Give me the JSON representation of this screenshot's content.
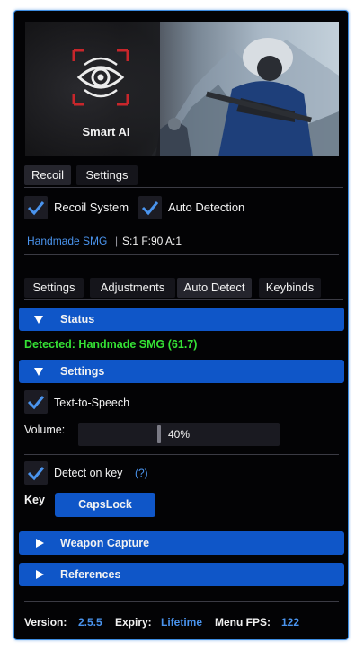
{
  "banner": {
    "logo_label": "Smart AI"
  },
  "main_tabs": [
    {
      "label": "Recoil"
    },
    {
      "label": "Settings"
    }
  ],
  "toggles": {
    "recoil_system": {
      "label": "Recoil System",
      "checked": true
    },
    "auto_detection": {
      "label": "Auto Detection",
      "checked": true
    }
  },
  "weapon_info": {
    "name": "Handmade SMG",
    "separator": "|",
    "stats": "S:1 F:90 A:1"
  },
  "sub_tabs": [
    {
      "label": "Settings"
    },
    {
      "label": "Adjustments"
    },
    {
      "label": "Auto Detect"
    },
    {
      "label": "Keybinds"
    }
  ],
  "sections": {
    "status": {
      "title": "Status",
      "expanded": true
    },
    "settings": {
      "title": "Settings",
      "expanded": true
    },
    "weapon_capture": {
      "title": "Weapon Capture",
      "expanded": false
    },
    "references": {
      "title": "References",
      "expanded": false
    }
  },
  "status": {
    "detected_text": "Detected: Handmade SMG (61.7)"
  },
  "settings": {
    "tts": {
      "label": "Text-to-Speech",
      "checked": true
    },
    "volume": {
      "label": "Volume:",
      "value_text": "40%",
      "value": 0.4
    },
    "detect_on_key": {
      "label": "Detect on key",
      "help": "(?)",
      "checked": true
    },
    "key": {
      "label": "Key",
      "button_label": "CapsLock"
    }
  },
  "footer": {
    "version_label": "Version:",
    "version_value": "2.5.5",
    "expiry_label": "Expiry:",
    "expiry_value": "Lifetime",
    "fps_label": "Menu FPS:",
    "fps_value": "122"
  },
  "colors": {
    "accent": "#0f56c8",
    "link": "#4a94ee",
    "success": "#35e235",
    "border": "#3d8ce0"
  }
}
